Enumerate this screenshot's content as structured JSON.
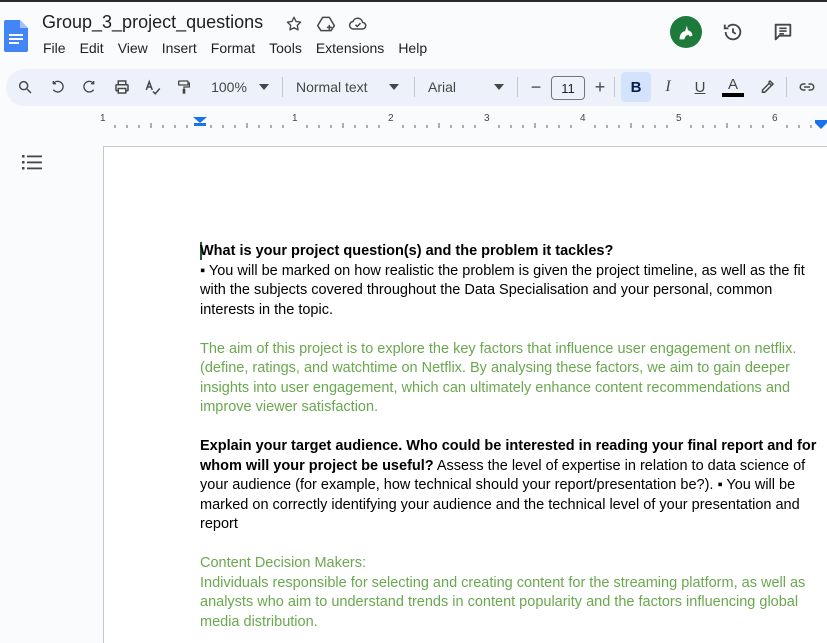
{
  "document": {
    "title": "Group_3_project_questions"
  },
  "menu": [
    "File",
    "Edit",
    "View",
    "Insert",
    "Format",
    "Tools",
    "Extensions",
    "Help"
  ],
  "toolbar": {
    "zoom": "100%",
    "style": "Normal text",
    "font": "Arial",
    "font_size": "11",
    "minus": "−",
    "plus": "+",
    "bold": "B",
    "italic": "I",
    "underline": "U",
    "text_color": "A"
  },
  "ruler": {
    "labels": [
      "1",
      "1",
      "2",
      "3",
      "4",
      "5",
      "6"
    ]
  },
  "body": {
    "q1_heading": "What is your project question(s) and the problem it tackles?",
    "q1_note": "▪ You will be marked on how realistic the problem is given the project timeline, as well as the fit with the subjects covered throughout the Data Specialisation and your personal, common interests in the topic.",
    "a1": "The aim of this project is to explore the key factors that influence user engagement on netflix. (define, ratings, and watchtime on Netflix. By analysing these factors, we aim to gain deeper insights into user engagement, which can ultimately enhance content recommendations and improve viewer satisfaction.",
    "q2_heading": "Explain your target audience. Who could be interested in reading your final report and for whom will your project be useful?",
    "q2_note": " Assess the level of expertise in relation to data science of your audience (for example, how technical should your report/presentation be?). ▪ You will be marked on correctly identifying your audience and the technical level of your presentation and report",
    "a2_title": "Content Decision Makers:",
    "a2_body": "Individuals responsible for selecting and creating content for the streaming platform, as well as analysts who aim to understand trends in content popularity and the factors influencing global media distribution."
  },
  "colors": {
    "answer_text": "#6aa84f",
    "avatar_bg": "#1e7a3a",
    "toolbar_bg": "#edf2fa",
    "bold_active": "#d3e3fd"
  }
}
